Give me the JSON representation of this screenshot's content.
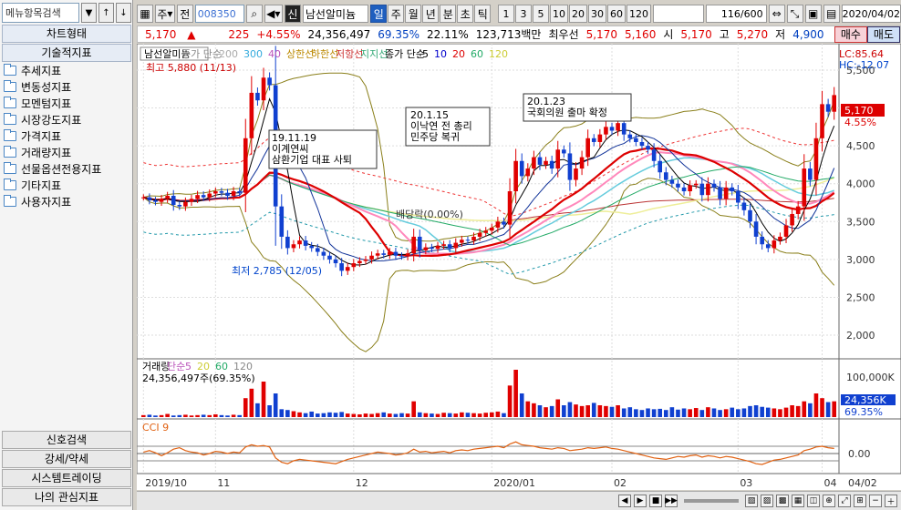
{
  "left": {
    "search_placeholder": "메뉴항목검색",
    "chart_type_label": "차트형태",
    "tech_indicator_label": "기술적지표",
    "tree": [
      "추세지표",
      "변동성지표",
      "모멘텀지표",
      "시장강도지표",
      "가격지표",
      "거래량지표",
      "선물옵션전용지표",
      "기타지표",
      "사용자지표"
    ],
    "bottom": [
      "신호검색",
      "강세/약세",
      "시스템트레이딩",
      "나의 관심지표"
    ]
  },
  "toolbar": {
    "period_combo": "주",
    "prev_label": "전",
    "code": "008350",
    "new_badge": "신",
    "stock_name": "남선알미늄",
    "periods": [
      "일",
      "주",
      "월",
      "년",
      "분",
      "초",
      "틱"
    ],
    "active_period": "일",
    "intervals": [
      "1",
      "3",
      "5",
      "10",
      "20",
      "30",
      "60",
      "120"
    ],
    "count": "116",
    "count_total": "/600",
    "date": "2020/04/02"
  },
  "price": {
    "cur": "5,170",
    "arrow": "▲",
    "chg": "225",
    "pct": "+4.55%",
    "vol": "24,356,497",
    "ratio1": "69.35%",
    "ratio2": "22.11%",
    "amt": "123,713백만",
    "pref_label": "최우선",
    "ask": "5,170",
    "bid": "5,160",
    "open_lbl": "시",
    "open": "5,170",
    "high_lbl": "고",
    "high": "5,270",
    "low_lbl": "저",
    "low": "4,900",
    "buy_btn": "매수",
    "sell_btn": "매도"
  },
  "chart_data": {
    "type": "candlestick",
    "legend_price": [
      "남선알미늄",
      "종가 단순",
      "200",
      "300",
      "40",
      "상한선",
      "하한선",
      "저항선",
      "지지선",
      "종가 단순",
      "5",
      "10",
      "20",
      "60",
      "120"
    ],
    "corner_right": [
      "LC:85.64",
      "HC:-12.07"
    ],
    "yticks": [
      "5,500",
      "5,000",
      "4,500",
      "4,000",
      "3,500",
      "3,000",
      "2,500",
      "2,000"
    ],
    "ytick_values": [
      5500,
      5000,
      4500,
      4000,
      3500,
      3000,
      2500,
      2000
    ],
    "ylim": [
      1700,
      5800
    ],
    "last_price_label": "5,170",
    "last_pct_label": "4.55%",
    "annotations": {
      "high": "최고 5,880 (11/13)",
      "low": "최저 2,785 (12/05)",
      "n1": [
        "19.11.19",
        "이계연씨",
        "삼환기업 대표 사퇴"
      ],
      "n2": [
        "20.1.15",
        "이낙연 전 총리",
        "민주당 복귀"
      ],
      "n3": [
        "20.1.23",
        "국회의원 출마 확정"
      ],
      "div": "배당락(0.00%)"
    },
    "closes": [
      3820,
      3780,
      3760,
      3800,
      3840,
      3720,
      3700,
      3760,
      3800,
      3850,
      3820,
      3870,
      3900,
      3880,
      3840,
      3900,
      3880,
      4600,
      5200,
      5100,
      5400,
      5300,
      3700,
      3300,
      3150,
      3200,
      3250,
      3180,
      3150,
      3100,
      3050,
      3000,
      2950,
      2850,
      2900,
      2950,
      2980,
      3000,
      3050,
      3080,
      3060,
      3100,
      3050,
      3040,
      3080,
      3300,
      3120,
      3160,
      3140,
      3180,
      3200,
      3150,
      3220,
      3260,
      3250,
      3300,
      3350,
      3380,
      3420,
      3500,
      3460,
      3900,
      4300,
      4100,
      4200,
      4350,
      4250,
      4300,
      4200,
      4450,
      4400,
      4050,
      4200,
      4350,
      4600,
      4550,
      4650,
      4750,
      4700,
      4800,
      4650,
      4600,
      4550,
      4500,
      4450,
      4300,
      4150,
      4050,
      4000,
      3950,
      3900,
      3980,
      4000,
      3850,
      4000,
      3950,
      3800,
      3950,
      3900,
      3750,
      3650,
      3500,
      3300,
      3200,
      3150,
      3250,
      3300,
      3450,
      3600,
      3700,
      4200,
      4050,
      4600,
      5050,
      4950,
      5170
    ],
    "volume_title": [
      "거래량",
      "단순",
      "5",
      "20",
      "60",
      "120"
    ],
    "volume_text": "24,356,497주(69.35%)",
    "volume_ytick": "100,000K",
    "volume_last": "24,356K",
    "volume_last_pct": "69.35%",
    "volumes": [
      5,
      6,
      4,
      5,
      8,
      4,
      5,
      6,
      4,
      5,
      6,
      5,
      7,
      5,
      4,
      6,
      5,
      48,
      72,
      35,
      90,
      30,
      60,
      20,
      18,
      15,
      12,
      10,
      14,
      9,
      10,
      12,
      11,
      13,
      9,
      8,
      7,
      9,
      8,
      10,
      12,
      9,
      8,
      10,
      9,
      40,
      12,
      10,
      9,
      8,
      11,
      10,
      9,
      12,
      11,
      10,
      9,
      11,
      12,
      14,
      10,
      80,
      120,
      60,
      40,
      35,
      30,
      25,
      28,
      45,
      30,
      38,
      32,
      28,
      30,
      36,
      30,
      28,
      26,
      30,
      22,
      25,
      20,
      18,
      22,
      20,
      21,
      18,
      25,
      19,
      22,
      20,
      23,
      18,
      25,
      22,
      18,
      20,
      24,
      20,
      22,
      28,
      30,
      26,
      24,
      22,
      20,
      24,
      30,
      28,
      40,
      35,
      60,
      48,
      38,
      40
    ],
    "cci_title": "CCI 9",
    "cci_ytick": "0.00",
    "cci": [
      20,
      40,
      10,
      -30,
      10,
      60,
      80,
      40,
      20,
      10,
      -20,
      0,
      30,
      20,
      0,
      20,
      10,
      90,
      120,
      100,
      110,
      90,
      -60,
      -120,
      -140,
      -100,
      -80,
      -90,
      -100,
      -110,
      -120,
      -130,
      -140,
      -110,
      -80,
      -60,
      -40,
      -20,
      0,
      20,
      10,
      0,
      -20,
      -10,
      10,
      60,
      20,
      30,
      10,
      20,
      30,
      10,
      40,
      50,
      40,
      60,
      70,
      80,
      90,
      100,
      80,
      130,
      160,
      120,
      110,
      100,
      80,
      70,
      60,
      80,
      70,
      40,
      50,
      60,
      80,
      70,
      80,
      90,
      70,
      60,
      40,
      20,
      0,
      -20,
      -40,
      -60,
      -70,
      -80,
      -60,
      -40,
      -50,
      -30,
      -20,
      -50,
      -30,
      -40,
      -60,
      -40,
      -50,
      -70,
      -90,
      -110,
      -140,
      -150,
      -120,
      -90,
      -80,
      -60,
      -40,
      -20,
      40,
      60,
      90,
      100,
      80,
      70
    ],
    "xticks": [
      "2019/10",
      "11",
      "12",
      "2020/01",
      "02",
      "03",
      "04"
    ],
    "xtick_idx": [
      0,
      12,
      35,
      58,
      78,
      99,
      113
    ],
    "x_right": "04/02"
  }
}
